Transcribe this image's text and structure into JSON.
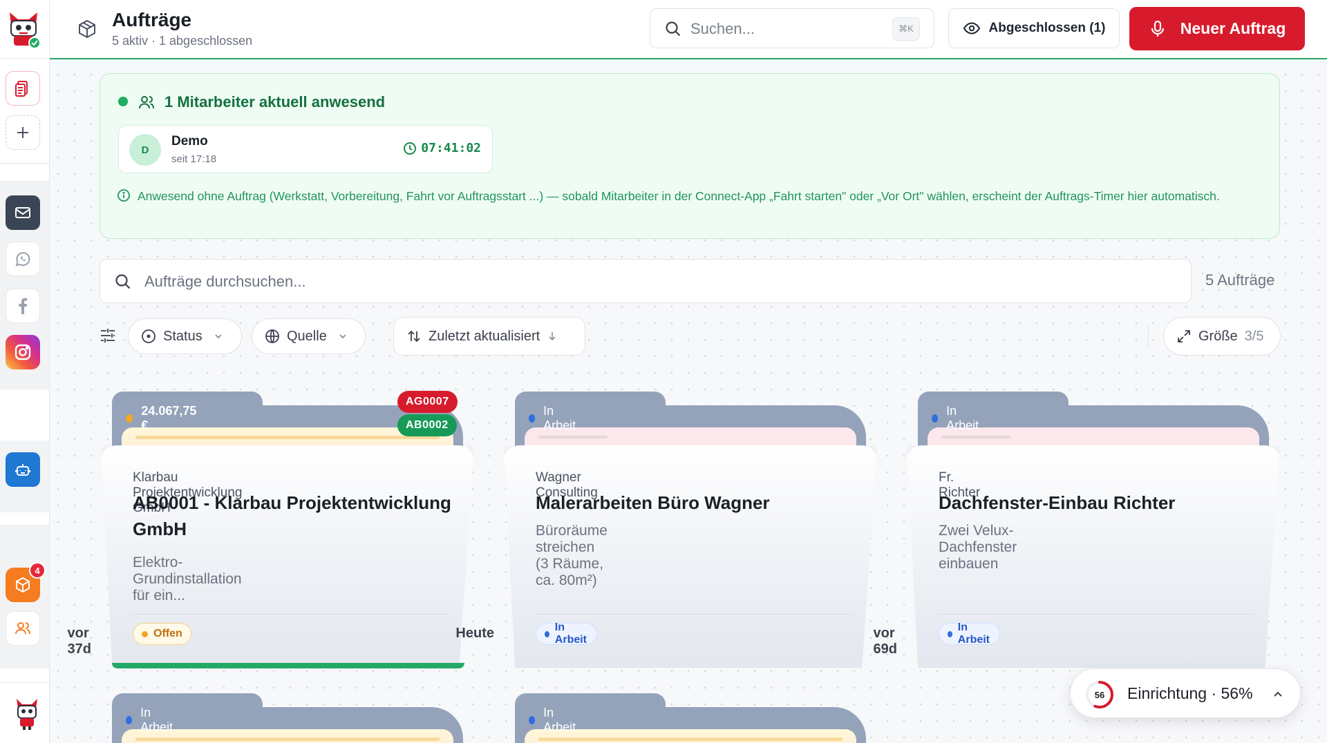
{
  "header": {
    "title": "Aufträge",
    "subtitle": "5 aktiv · 1 abgeschlossen",
    "search_placeholder": "Suchen...",
    "search_shortcut": "⌘K",
    "completed_button": "Abgeschlossen (1)",
    "new_order_button": "Neuer Auftrag",
    "accent_color": "#d71b2c"
  },
  "sidebar": {
    "items": [
      {
        "icon": "document-icon"
      },
      {
        "icon": "plus-icon"
      },
      {
        "icon": "mail-icon"
      },
      {
        "icon": "whatsapp-icon"
      },
      {
        "icon": "facebook-icon"
      },
      {
        "icon": "instagram-icon"
      },
      {
        "icon": "bot-icon"
      },
      {
        "icon": "box-icon",
        "badge": "4"
      },
      {
        "icon": "team-icon"
      }
    ]
  },
  "presence": {
    "title": "1 Mitarbeiter aktuell anwesend",
    "employee": {
      "initial": "D",
      "name": "Demo",
      "since": "seit 17:18",
      "timer": "07:41:02"
    },
    "info": "Anwesend ohne Auftrag (Werkstatt, Vorbereitung, Fahrt vor Auftragsstart ...) — sobald Mitarbeiter in der Connect-App „Fahrt starten\" oder „Vor Ort\" wählen, erscheint der Auftrags-Timer hier automatisch."
  },
  "order_search": {
    "placeholder": "Aufträge durchsuchen...",
    "count": "5 Aufträge"
  },
  "filters": {
    "status": "Status",
    "source": "Quelle",
    "sort": "Zuletzt aktualisiert",
    "size_label": "Größe",
    "size_value": "3/5"
  },
  "orders": [
    {
      "tab_label": "24.067,75 €",
      "badges": [
        "AG0007",
        "AB0002"
      ],
      "client": "Klarbau Projektentwicklung GmbH",
      "title": "AB0001 - Klarbau Projektentwicklung GmbH",
      "description": "Elektro-Grundinstallation für ein...",
      "status": "Offen",
      "age": "vor 37d"
    },
    {
      "tab_label": "In Arbeit",
      "client": "Wagner Consulting",
      "title": "Malerarbeiten Büro Wagner",
      "description": "Büroräume streichen (3 Räume, ca. 80m²)",
      "status": "In Arbeit",
      "age": "Heute"
    },
    {
      "tab_label": "In Arbeit",
      "client": "Fr. Richter",
      "title": "Dachfenster-Einbau Richter",
      "description": "Zwei Velux-Dachfenster einbauen",
      "status": "In Arbeit",
      "age": "vor 69d"
    },
    {
      "tab_label": "In Arbeit"
    },
    {
      "tab_label": "In Arbeit"
    }
  ],
  "setup": {
    "progress": 56,
    "percent_text": "56",
    "label": "Einrichtung · 56%"
  }
}
